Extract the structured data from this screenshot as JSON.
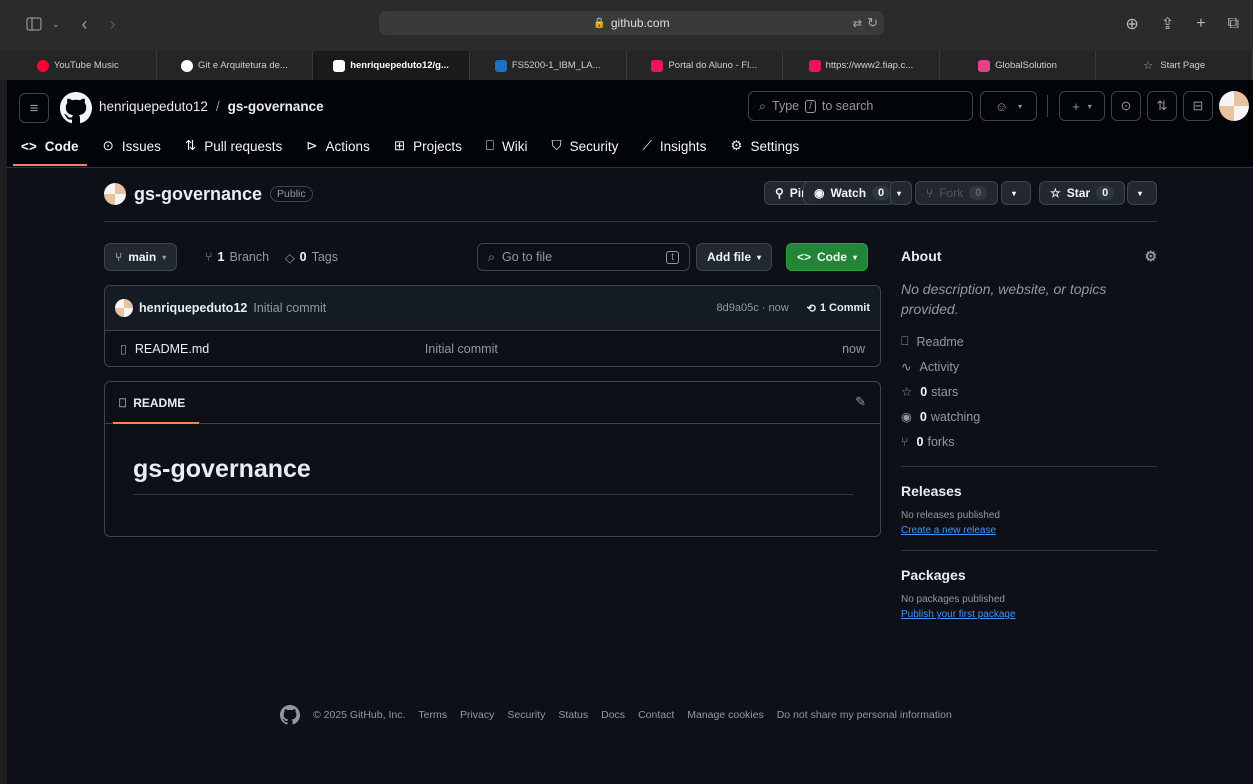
{
  "browser": {
    "url": "github.com"
  },
  "tabs": [
    {
      "label": "YouTube Music",
      "color": "#ff0033",
      "icon": "youtube-music-icon"
    },
    {
      "label": "Git e Arquitetura de...",
      "color": "#ffffff",
      "icon": "openai-icon"
    },
    {
      "label": "henriquepeduto12/g...",
      "color": "#ffffff",
      "icon": "github-icon",
      "active": true
    },
    {
      "label": "FS5200-1_IBM_LA...",
      "color": "#1f70c1",
      "icon": "ibm-icon"
    },
    {
      "label": "Portal do Aluno - Fl...",
      "color": "#ed145b",
      "icon": "fiap-icon"
    },
    {
      "label": "https://www2.fiap.c...",
      "color": "#ed145b",
      "icon": "fiap-icon"
    },
    {
      "label": "GlobalSolution",
      "color": "#e0438c",
      "icon": "figma-icon"
    },
    {
      "label": "Start Page",
      "color": "#aaaaaa",
      "icon": "star-icon"
    }
  ],
  "header": {
    "owner": "henriquepeduto12",
    "sep": "/",
    "repo": "gs-governance",
    "search_pre": "Type",
    "search_key": "/",
    "search_post": "to search"
  },
  "nav": [
    "Code",
    "Issues",
    "Pull requests",
    "Actions",
    "Projects",
    "Wiki",
    "Security",
    "Insights",
    "Settings"
  ],
  "repo": {
    "name": "gs-governance",
    "visibility": "Public",
    "pin": "Pin",
    "watch": "Watch",
    "watch_count": "0",
    "fork": "Fork",
    "fork_count": "0",
    "star": "Star",
    "star_count": "0"
  },
  "toolbar": {
    "branch": "main",
    "branches_n": "1",
    "branches": "Branch",
    "tags_n": "0",
    "tags": "Tags",
    "goto": "Go to file",
    "goto_key": "t",
    "add_file": "Add file",
    "code": "Code"
  },
  "commit": {
    "author": "henriquepeduto12",
    "message": "Initial commit",
    "hash": "8d9a05c · now",
    "count": "1 Commit"
  },
  "files": [
    {
      "name": "README.md",
      "message": "Initial commit",
      "time": "now"
    }
  ],
  "readme": {
    "tab": "README",
    "heading": "gs-governance"
  },
  "about": {
    "title": "About",
    "desc": "No description, website, or topics provided.",
    "readme": "Readme",
    "activity": "Activity",
    "stars_n": "0",
    "stars": "stars",
    "watching_n": "0",
    "watching": "watching",
    "forks_n": "0",
    "forks": "forks"
  },
  "releases": {
    "title": "Releases",
    "none": "No releases published",
    "link": "Create a new release"
  },
  "packages": {
    "title": "Packages",
    "none": "No packages published",
    "link": "Publish your first package"
  },
  "footer": {
    "copy": "© 2025 GitHub, Inc.",
    "links": [
      "Terms",
      "Privacy",
      "Security",
      "Status",
      "Docs",
      "Contact",
      "Manage cookies",
      "Do not share my personal information"
    ]
  }
}
